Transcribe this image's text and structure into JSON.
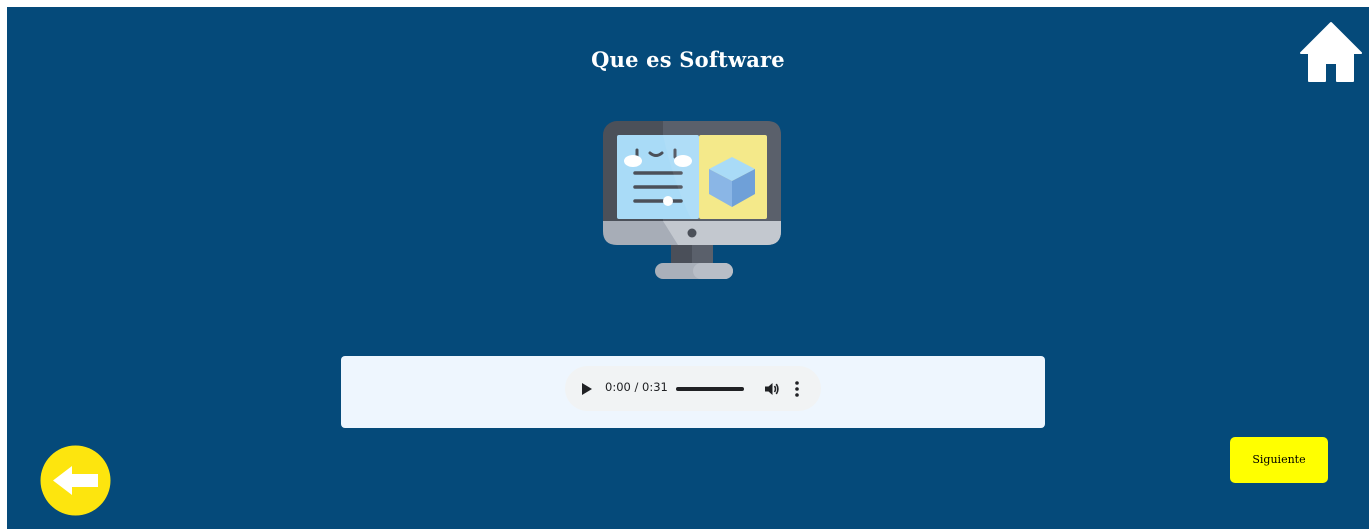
{
  "page": {
    "title": "Que es Software",
    "background_color": "#054a7a"
  },
  "nav": {
    "home_icon": "home-icon",
    "back_icon": "arrow-left-icon",
    "back_color": "#fde50e",
    "next_label": "Siguiente",
    "next_color": "#ffff00"
  },
  "illustration": {
    "icon": "computer-monitor-icon"
  },
  "audio": {
    "time_display": "0:00 / 0:31",
    "progress": 0,
    "play_icon": "play-icon",
    "volume_icon": "volume-icon",
    "more_icon": "more-options-icon"
  }
}
